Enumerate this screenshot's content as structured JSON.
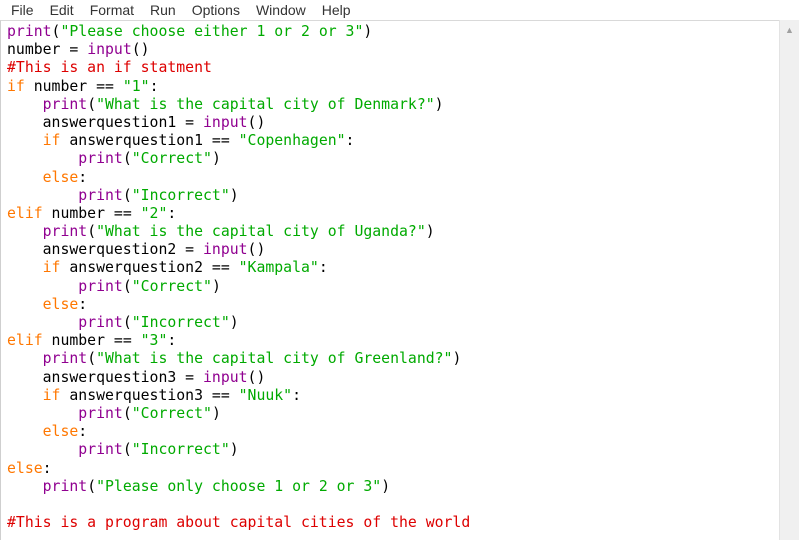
{
  "menu": [
    "File",
    "Edit",
    "Format",
    "Run",
    "Options",
    "Window",
    "Help"
  ],
  "code_lines": [
    [
      {
        "t": "print",
        "k": "builtin"
      },
      {
        "t": "(",
        "k": "plain"
      },
      {
        "t": "\"Please choose either 1 or 2 or 3\"",
        "k": "string"
      },
      {
        "t": ")",
        "k": "plain"
      }
    ],
    [
      {
        "t": "number = ",
        "k": "plain"
      },
      {
        "t": "input",
        "k": "builtin"
      },
      {
        "t": "()",
        "k": "plain"
      }
    ],
    [
      {
        "t": "#This is an if statment",
        "k": "comment"
      }
    ],
    [
      {
        "t": "if",
        "k": "keyword"
      },
      {
        "t": " number == ",
        "k": "plain"
      },
      {
        "t": "\"1\"",
        "k": "string"
      },
      {
        "t": ":",
        "k": "plain"
      }
    ],
    [
      {
        "t": "    ",
        "k": "plain"
      },
      {
        "t": "print",
        "k": "builtin"
      },
      {
        "t": "(",
        "k": "plain"
      },
      {
        "t": "\"What is the capital city of Denmark?\"",
        "k": "string"
      },
      {
        "t": ")",
        "k": "plain"
      }
    ],
    [
      {
        "t": "    answerquestion1 = ",
        "k": "plain"
      },
      {
        "t": "input",
        "k": "builtin"
      },
      {
        "t": "()",
        "k": "plain"
      }
    ],
    [
      {
        "t": "    ",
        "k": "plain"
      },
      {
        "t": "if",
        "k": "keyword"
      },
      {
        "t": " answerquestion1 == ",
        "k": "plain"
      },
      {
        "t": "\"Copenhagen\"",
        "k": "string"
      },
      {
        "t": ":",
        "k": "plain"
      }
    ],
    [
      {
        "t": "        ",
        "k": "plain"
      },
      {
        "t": "print",
        "k": "builtin"
      },
      {
        "t": "(",
        "k": "plain"
      },
      {
        "t": "\"Correct\"",
        "k": "string"
      },
      {
        "t": ")",
        "k": "plain"
      }
    ],
    [
      {
        "t": "    ",
        "k": "plain"
      },
      {
        "t": "else",
        "k": "keyword"
      },
      {
        "t": ":",
        "k": "plain"
      }
    ],
    [
      {
        "t": "        ",
        "k": "plain"
      },
      {
        "t": "print",
        "k": "builtin"
      },
      {
        "t": "(",
        "k": "plain"
      },
      {
        "t": "\"Incorrect\"",
        "k": "string"
      },
      {
        "t": ")",
        "k": "plain"
      }
    ],
    [
      {
        "t": "elif",
        "k": "keyword"
      },
      {
        "t": " number == ",
        "k": "plain"
      },
      {
        "t": "\"2\"",
        "k": "string"
      },
      {
        "t": ":",
        "k": "plain"
      }
    ],
    [
      {
        "t": "    ",
        "k": "plain"
      },
      {
        "t": "print",
        "k": "builtin"
      },
      {
        "t": "(",
        "k": "plain"
      },
      {
        "t": "\"What is the capital city of Uganda?\"",
        "k": "string"
      },
      {
        "t": ")",
        "k": "plain"
      }
    ],
    [
      {
        "t": "    answerquestion2 = ",
        "k": "plain"
      },
      {
        "t": "input",
        "k": "builtin"
      },
      {
        "t": "()",
        "k": "plain"
      }
    ],
    [
      {
        "t": "    ",
        "k": "plain"
      },
      {
        "t": "if",
        "k": "keyword"
      },
      {
        "t": " answerquestion2 == ",
        "k": "plain"
      },
      {
        "t": "\"Kampala\"",
        "k": "string"
      },
      {
        "t": ":",
        "k": "plain"
      }
    ],
    [
      {
        "t": "        ",
        "k": "plain"
      },
      {
        "t": "print",
        "k": "builtin"
      },
      {
        "t": "(",
        "k": "plain"
      },
      {
        "t": "\"Correct\"",
        "k": "string"
      },
      {
        "t": ")",
        "k": "plain"
      }
    ],
    [
      {
        "t": "    ",
        "k": "plain"
      },
      {
        "t": "else",
        "k": "keyword"
      },
      {
        "t": ":",
        "k": "plain"
      }
    ],
    [
      {
        "t": "        ",
        "k": "plain"
      },
      {
        "t": "print",
        "k": "builtin"
      },
      {
        "t": "(",
        "k": "plain"
      },
      {
        "t": "\"Incorrect\"",
        "k": "string"
      },
      {
        "t": ")",
        "k": "plain"
      }
    ],
    [
      {
        "t": "elif",
        "k": "keyword"
      },
      {
        "t": " number == ",
        "k": "plain"
      },
      {
        "t": "\"3\"",
        "k": "string"
      },
      {
        "t": ":",
        "k": "plain"
      }
    ],
    [
      {
        "t": "    ",
        "k": "plain"
      },
      {
        "t": "print",
        "k": "builtin"
      },
      {
        "t": "(",
        "k": "plain"
      },
      {
        "t": "\"What is the capital city of Greenland?\"",
        "k": "string"
      },
      {
        "t": ")",
        "k": "plain"
      }
    ],
    [
      {
        "t": "    answerquestion3 = ",
        "k": "plain"
      },
      {
        "t": "input",
        "k": "builtin"
      },
      {
        "t": "()",
        "k": "plain"
      }
    ],
    [
      {
        "t": "    ",
        "k": "plain"
      },
      {
        "t": "if",
        "k": "keyword"
      },
      {
        "t": " answerquestion3 == ",
        "k": "plain"
      },
      {
        "t": "\"Nuuk\"",
        "k": "string"
      },
      {
        "t": ":",
        "k": "plain"
      }
    ],
    [
      {
        "t": "        ",
        "k": "plain"
      },
      {
        "t": "print",
        "k": "builtin"
      },
      {
        "t": "(",
        "k": "plain"
      },
      {
        "t": "\"Correct\"",
        "k": "string"
      },
      {
        "t": ")",
        "k": "plain"
      }
    ],
    [
      {
        "t": "    ",
        "k": "plain"
      },
      {
        "t": "else",
        "k": "keyword"
      },
      {
        "t": ":",
        "k": "plain"
      }
    ],
    [
      {
        "t": "        ",
        "k": "plain"
      },
      {
        "t": "print",
        "k": "builtin"
      },
      {
        "t": "(",
        "k": "plain"
      },
      {
        "t": "\"Incorrect\"",
        "k": "string"
      },
      {
        "t": ")",
        "k": "plain"
      }
    ],
    [
      {
        "t": "else",
        "k": "keyword"
      },
      {
        "t": ":",
        "k": "plain"
      }
    ],
    [
      {
        "t": "    ",
        "k": "plain"
      },
      {
        "t": "print",
        "k": "builtin"
      },
      {
        "t": "(",
        "k": "plain"
      },
      {
        "t": "\"Please only choose 1 or 2 or 3\"",
        "k": "string"
      },
      {
        "t": ")",
        "k": "plain"
      }
    ],
    [],
    [
      {
        "t": "#This is a program about capital cities of the world",
        "k": "comment"
      }
    ]
  ],
  "colors": {
    "builtin": "#900090",
    "string": "#00aa00",
    "keyword": "#ff7700",
    "comment": "#dd0000",
    "plain": "#000000"
  },
  "scrollbar": {
    "up_icon": "scroll-up-arrow-icon",
    "up_glyph": "▲"
  }
}
